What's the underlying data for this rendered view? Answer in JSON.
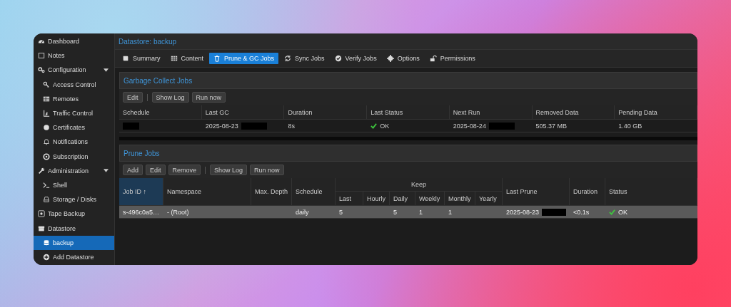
{
  "sidebar": {
    "items": [
      {
        "label": "Dashboard",
        "selected": false
      },
      {
        "label": "Notes",
        "selected": false
      },
      {
        "label": "Configuration",
        "selected": false,
        "expanded": true,
        "children": [
          {
            "label": "Access Control",
            "selected": false
          },
          {
            "label": "Remotes",
            "selected": false
          },
          {
            "label": "Traffic Control",
            "selected": false
          },
          {
            "label": "Certificates",
            "selected": false
          },
          {
            "label": "Notifications",
            "selected": false
          },
          {
            "label": "Subscription",
            "selected": false
          }
        ]
      },
      {
        "label": "Administration",
        "selected": false,
        "expanded": true,
        "children": [
          {
            "label": "Shell",
            "selected": false
          },
          {
            "label": "Storage / Disks",
            "selected": false
          }
        ]
      },
      {
        "label": "Tape Backup",
        "selected": false
      },
      {
        "label": "Datastore",
        "selected": false,
        "children": [
          {
            "label": "backup",
            "selected": true
          },
          {
            "label": "Add Datastore",
            "selected": false
          }
        ]
      }
    ]
  },
  "title": "Datastore: backup",
  "tabs": [
    {
      "label": "Summary",
      "selected": false
    },
    {
      "label": "Content",
      "selected": false
    },
    {
      "label": "Prune & GC Jobs",
      "selected": true
    },
    {
      "label": "Sync Jobs",
      "selected": false
    },
    {
      "label": "Verify Jobs",
      "selected": false
    },
    {
      "label": "Options",
      "selected": false
    },
    {
      "label": "Permissions",
      "selected": false
    }
  ],
  "gc_jobs": {
    "title": "Garbage Collect Jobs",
    "buttons": [
      {
        "label": "Edit",
        "separator_after": true
      },
      {
        "label": "Show Log"
      },
      {
        "label": "Run now"
      }
    ],
    "columns": [
      {
        "label": "Schedule"
      },
      {
        "label": "Last GC"
      },
      {
        "label": "Duration"
      },
      {
        "label": "Last Status"
      },
      {
        "label": "Next Run"
      },
      {
        "label": "Removed Data"
      },
      {
        "label": "Pending Data"
      }
    ],
    "rows": [
      {
        "selected": false,
        "cells": [
          {
            "redacted": true
          },
          {
            "text": "2025-08-23",
            "redacted": true
          },
          {
            "text": "8s"
          },
          {
            "text": "OK",
            "kind": "status"
          },
          {
            "text": "2025-08-24",
            "redacted": true
          },
          {
            "text": "505.37 MB"
          },
          {
            "text": "1.40 GB"
          }
        ]
      }
    ]
  },
  "prune_jobs": {
    "title": "Prune Jobs",
    "column_group": {
      "label": "Keep"
    },
    "buttons": [
      {
        "label": "Add"
      },
      {
        "label": "Edit"
      },
      {
        "label": "Remove",
        "separator_after": true
      },
      {
        "label": "Show Log"
      },
      {
        "label": "Run now"
      }
    ],
    "columns": [
      {
        "label": "Job ID",
        "sort_arrow": "↑"
      },
      {
        "label": "Namespace"
      },
      {
        "label": "Max. Depth"
      },
      {
        "label": "Schedule"
      },
      {
        "label": "Last",
        "in_group": true
      },
      {
        "label": "Hourly",
        "in_group": true
      },
      {
        "label": "Daily",
        "in_group": true
      },
      {
        "label": "Weekly",
        "in_group": true
      },
      {
        "label": "Monthly",
        "in_group": true
      },
      {
        "label": "Yearly",
        "in_group": true
      },
      {
        "label": "Last Prune"
      },
      {
        "label": "Duration"
      },
      {
        "label": "Status"
      }
    ],
    "rows": [
      {
        "selected": true,
        "cells": [
          {
            "text": "s-496c0a5…"
          },
          {
            "text": "- (Root)"
          },
          {
            "text": ""
          },
          {
            "text": "daily"
          },
          {
            "text": "5"
          },
          {
            "text": ""
          },
          {
            "text": "5"
          },
          {
            "text": "1"
          },
          {
            "text": "1"
          },
          {
            "text": ""
          },
          {
            "text": "2025-08-23",
            "redacted": true
          },
          {
            "text": "<0.1s"
          },
          {
            "text": "OK",
            "kind": "status"
          }
        ]
      }
    ]
  }
}
